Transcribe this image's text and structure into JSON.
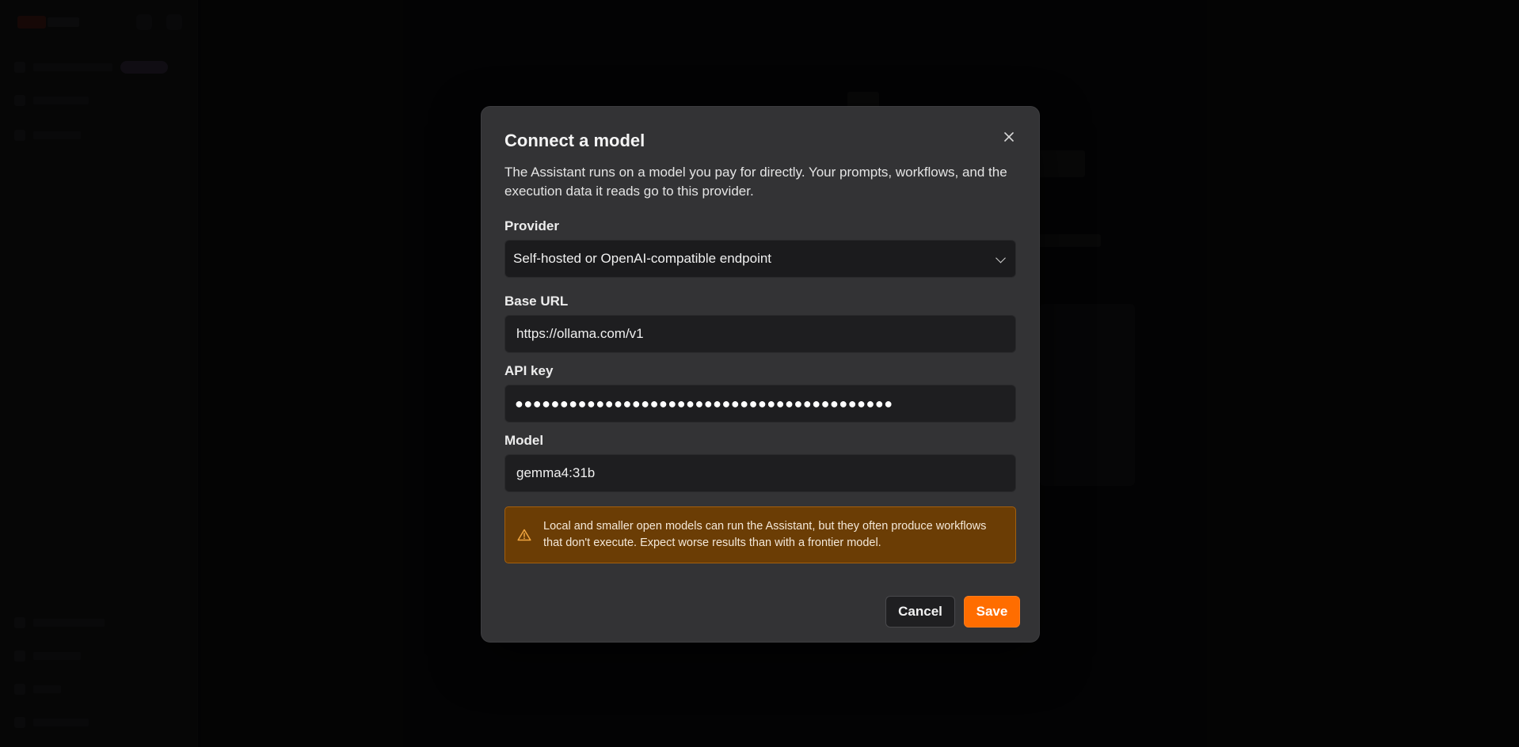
{
  "modal": {
    "title": "Connect a model",
    "description": "The Assistant runs on a model you pay for directly. Your prompts, workflows, and the execution data it reads go to this provider.",
    "close_icon": "close-icon",
    "provider": {
      "label": "Provider",
      "selected": "Self-hosted or OpenAI-compatible endpoint",
      "icon": "chevron-down-icon"
    },
    "base_url": {
      "label": "Base URL",
      "value": "https://ollama.com/v1"
    },
    "api_key": {
      "label": "API key",
      "masked_value": "●●●●●●●●●●●●●●●●●●●●●●●●●●●●●●●●●●●●●●●●●●"
    },
    "model": {
      "label": "Model",
      "value": "gemma4:31b"
    },
    "warning": {
      "icon": "warning-triangle-icon",
      "text": "Local and smaller open models can run the Assistant, but they often produce workflows that don't execute. Expect worse results than with a frontier model."
    },
    "buttons": {
      "cancel": "Cancel",
      "save": "Save"
    }
  },
  "colors": {
    "accent": "#ff6d00",
    "warning_bg": "#6b3d05",
    "modal_bg": "#333335"
  }
}
